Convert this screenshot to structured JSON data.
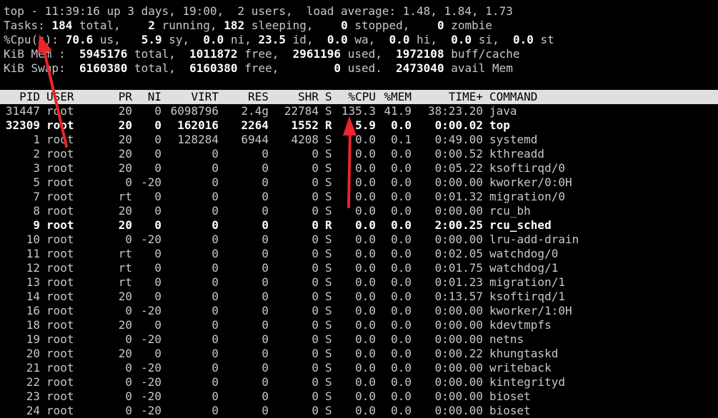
{
  "summary": {
    "line1": "top - 11:39:16 up 3 days, 19:00,  2 users,  load average: 1.48, 1.84, 1.73",
    "tasks": {
      "label": "Tasks:",
      "total": "184",
      "total_lbl": "total,",
      "running": "2",
      "running_lbl": "running,",
      "sleeping": "182",
      "sleeping_lbl": "sleeping,",
      "stopped": "0",
      "stopped_lbl": "stopped,",
      "zombie": "0",
      "zombie_lbl": "zombie"
    },
    "cpu": {
      "label": "%Cpu(s):",
      "us": "70.6",
      "us_lbl": "us,",
      "sy": "5.9",
      "sy_lbl": "sy,",
      "ni": "0.0",
      "ni_lbl": "ni,",
      "id": "23.5",
      "id_lbl": "id,",
      "wa": "0.0",
      "wa_lbl": "wa,",
      "hi": "0.0",
      "hi_lbl": "hi,",
      "si": "0.0",
      "si_lbl": "si,",
      "st": "0.0",
      "st_lbl": "st"
    },
    "mem": {
      "label": "KiB Mem :",
      "total": "5945176",
      "total_lbl": "total,",
      "free": "1011872",
      "free_lbl": "free,",
      "used": "2961196",
      "used_lbl": "used,",
      "cache": "1972108",
      "cache_lbl": "buff/cache"
    },
    "swap": {
      "label": "KiB Swap:",
      "total": "6160380",
      "total_lbl": "total,",
      "free": "6160380",
      "free_lbl": "free,",
      "used": "0",
      "used_lbl": "used.",
      "avail": "2473040",
      "avail_lbl": "avail Mem"
    }
  },
  "columns": [
    "PID",
    "USER",
    "PR",
    "NI",
    "VIRT",
    "RES",
    "SHR",
    "S",
    "%CPU",
    "%MEM",
    "TIME+",
    "COMMAND"
  ],
  "processes": [
    {
      "pid": "31447",
      "user": "root",
      "pr": "20",
      "ni": "0",
      "virt": "6098796",
      "res": "2.4g",
      "shr": "22784",
      "s": "S",
      "cpu": "135.3",
      "mem": "41.9",
      "time": "38:23.20",
      "cmd": "java",
      "bold": false
    },
    {
      "pid": "32309",
      "user": "root",
      "pr": "20",
      "ni": "0",
      "virt": "162016",
      "res": "2264",
      "shr": "1552",
      "s": "R",
      "cpu": "5.9",
      "mem": "0.0",
      "time": "0:00.02",
      "cmd": "top",
      "bold": true
    },
    {
      "pid": "1",
      "user": "root",
      "pr": "20",
      "ni": "0",
      "virt": "128284",
      "res": "6944",
      "shr": "4208",
      "s": "S",
      "cpu": "0.0",
      "mem": "0.1",
      "time": "0:49.00",
      "cmd": "systemd",
      "bold": false
    },
    {
      "pid": "2",
      "user": "root",
      "pr": "20",
      "ni": "0",
      "virt": "0",
      "res": "0",
      "shr": "0",
      "s": "S",
      "cpu": "0.0",
      "mem": "0.0",
      "time": "0:00.52",
      "cmd": "kthreadd",
      "bold": false
    },
    {
      "pid": "3",
      "user": "root",
      "pr": "20",
      "ni": "0",
      "virt": "0",
      "res": "0",
      "shr": "0",
      "s": "S",
      "cpu": "0.0",
      "mem": "0.0",
      "time": "0:05.22",
      "cmd": "ksoftirqd/0",
      "bold": false
    },
    {
      "pid": "5",
      "user": "root",
      "pr": "0",
      "ni": "-20",
      "virt": "0",
      "res": "0",
      "shr": "0",
      "s": "S",
      "cpu": "0.0",
      "mem": "0.0",
      "time": "0:00.00",
      "cmd": "kworker/0:0H",
      "bold": false
    },
    {
      "pid": "7",
      "user": "root",
      "pr": "rt",
      "ni": "0",
      "virt": "0",
      "res": "0",
      "shr": "0",
      "s": "S",
      "cpu": "0.0",
      "mem": "0.0",
      "time": "0:01.32",
      "cmd": "migration/0",
      "bold": false
    },
    {
      "pid": "8",
      "user": "root",
      "pr": "20",
      "ni": "0",
      "virt": "0",
      "res": "0",
      "shr": "0",
      "s": "S",
      "cpu": "0.0",
      "mem": "0.0",
      "time": "0:00.00",
      "cmd": "rcu_bh",
      "bold": false
    },
    {
      "pid": "9",
      "user": "root",
      "pr": "20",
      "ni": "0",
      "virt": "0",
      "res": "0",
      "shr": "0",
      "s": "R",
      "cpu": "0.0",
      "mem": "0.0",
      "time": "2:00.25",
      "cmd": "rcu_sched",
      "bold": true
    },
    {
      "pid": "10",
      "user": "root",
      "pr": "0",
      "ni": "-20",
      "virt": "0",
      "res": "0",
      "shr": "0",
      "s": "S",
      "cpu": "0.0",
      "mem": "0.0",
      "time": "0:00.00",
      "cmd": "lru-add-drain",
      "bold": false
    },
    {
      "pid": "11",
      "user": "root",
      "pr": "rt",
      "ni": "0",
      "virt": "0",
      "res": "0",
      "shr": "0",
      "s": "S",
      "cpu": "0.0",
      "mem": "0.0",
      "time": "0:02.05",
      "cmd": "watchdog/0",
      "bold": false
    },
    {
      "pid": "12",
      "user": "root",
      "pr": "rt",
      "ni": "0",
      "virt": "0",
      "res": "0",
      "shr": "0",
      "s": "S",
      "cpu": "0.0",
      "mem": "0.0",
      "time": "0:01.75",
      "cmd": "watchdog/1",
      "bold": false
    },
    {
      "pid": "13",
      "user": "root",
      "pr": "rt",
      "ni": "0",
      "virt": "0",
      "res": "0",
      "shr": "0",
      "s": "S",
      "cpu": "0.0",
      "mem": "0.0",
      "time": "0:01.23",
      "cmd": "migration/1",
      "bold": false
    },
    {
      "pid": "14",
      "user": "root",
      "pr": "20",
      "ni": "0",
      "virt": "0",
      "res": "0",
      "shr": "0",
      "s": "S",
      "cpu": "0.0",
      "mem": "0.0",
      "time": "0:13.57",
      "cmd": "ksoftirqd/1",
      "bold": false
    },
    {
      "pid": "16",
      "user": "root",
      "pr": "0",
      "ni": "-20",
      "virt": "0",
      "res": "0",
      "shr": "0",
      "s": "S",
      "cpu": "0.0",
      "mem": "0.0",
      "time": "0:00.00",
      "cmd": "kworker/1:0H",
      "bold": false
    },
    {
      "pid": "18",
      "user": "root",
      "pr": "20",
      "ni": "0",
      "virt": "0",
      "res": "0",
      "shr": "0",
      "s": "S",
      "cpu": "0.0",
      "mem": "0.0",
      "time": "0:00.00",
      "cmd": "kdevtmpfs",
      "bold": false
    },
    {
      "pid": "19",
      "user": "root",
      "pr": "0",
      "ni": "-20",
      "virt": "0",
      "res": "0",
      "shr": "0",
      "s": "S",
      "cpu": "0.0",
      "mem": "0.0",
      "time": "0:00.00",
      "cmd": "netns",
      "bold": false
    },
    {
      "pid": "20",
      "user": "root",
      "pr": "20",
      "ni": "0",
      "virt": "0",
      "res": "0",
      "shr": "0",
      "s": "S",
      "cpu": "0.0",
      "mem": "0.0",
      "time": "0:00.22",
      "cmd": "khungtaskd",
      "bold": false
    },
    {
      "pid": "21",
      "user": "root",
      "pr": "0",
      "ni": "-20",
      "virt": "0",
      "res": "0",
      "shr": "0",
      "s": "S",
      "cpu": "0.0",
      "mem": "0.0",
      "time": "0:00.00",
      "cmd": "writeback",
      "bold": false
    },
    {
      "pid": "22",
      "user": "root",
      "pr": "0",
      "ni": "-20",
      "virt": "0",
      "res": "0",
      "shr": "0",
      "s": "S",
      "cpu": "0.0",
      "mem": "0.0",
      "time": "0:00.00",
      "cmd": "kintegrityd",
      "bold": false
    },
    {
      "pid": "23",
      "user": "root",
      "pr": "0",
      "ni": "-20",
      "virt": "0",
      "res": "0",
      "shr": "0",
      "s": "S",
      "cpu": "0.0",
      "mem": "0.0",
      "time": "0:00.00",
      "cmd": "bioset",
      "bold": false
    },
    {
      "pid": "24",
      "user": "root",
      "pr": "0",
      "ni": "-20",
      "virt": "0",
      "res": "0",
      "shr": "0",
      "s": "S",
      "cpu": "0.0",
      "mem": "0.0",
      "time": "0:00.00",
      "cmd": "bioset",
      "bold": false
    }
  ],
  "colors": {
    "background": "#000000",
    "text": "#c8c8c8",
    "bold_text": "#ffffff",
    "header_bar": "#e0e0e0",
    "annotation_arrow": "#e8262b"
  },
  "annotations": [
    "red-arrow-to-cpu-summary",
    "red-arrow-to-java-cpu"
  ]
}
